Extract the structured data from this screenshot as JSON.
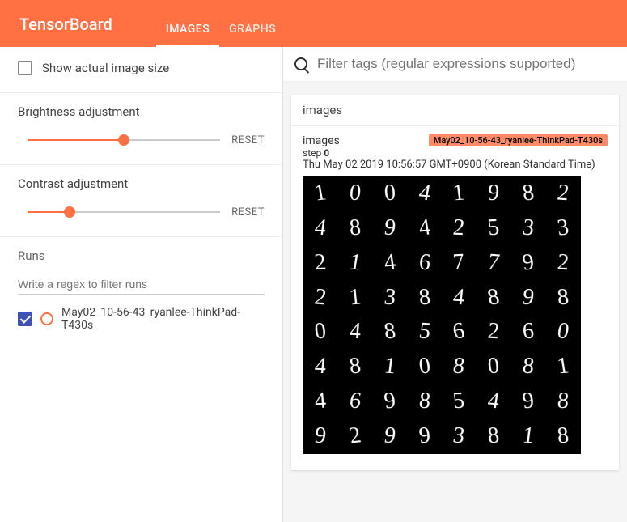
{
  "header": {
    "brand": "TensorBoard",
    "tabs": [
      {
        "label": "IMAGES",
        "active": true
      },
      {
        "label": "GRAPHS",
        "active": false
      }
    ]
  },
  "sidebar": {
    "show_actual_label": "Show actual image size",
    "show_actual_checked": false,
    "brightness": {
      "title": "Brightness adjustment",
      "reset_label": "RESET",
      "value_pct": 50
    },
    "contrast": {
      "title": "Contrast adjustment",
      "reset_label": "RESET",
      "value_pct": 22
    },
    "runs": {
      "title": "Runs",
      "filter_placeholder": "Write a regex to filter runs",
      "items": [
        {
          "checked": true,
          "label": "May02_10-56-43_ryanlee-ThinkPad-T430s"
        }
      ]
    }
  },
  "content": {
    "search_placeholder": "Filter tags (regular expressions supported)",
    "card": {
      "header": "images",
      "tag": "images",
      "badge": "May02_10-56-43_ryanlee-ThinkPad-T430s",
      "step_label": "step",
      "step_value": "0",
      "timestamp": "Thu May 02 2019 10:56:57 GMT+0900 (Korean Standard Time)",
      "digits": [
        [
          "1",
          "0",
          "0",
          "4",
          "1",
          "9",
          "8",
          "2"
        ],
        [
          "4",
          "8",
          "9",
          "4",
          "2",
          "5",
          "3",
          "3"
        ],
        [
          "2",
          "1",
          "4",
          "6",
          "7",
          "7",
          "9",
          "2"
        ],
        [
          "2",
          "1",
          "3",
          "8",
          "4",
          "8",
          "9",
          "8"
        ],
        [
          "0",
          "4",
          "8",
          "5",
          "6",
          "2",
          "6",
          "0"
        ],
        [
          "4",
          "8",
          "1",
          "0",
          "8",
          "0",
          "8",
          "1"
        ],
        [
          "4",
          "6",
          "9",
          "8",
          "5",
          "4",
          "9",
          "8"
        ],
        [
          "9",
          "2",
          "9",
          "9",
          "3",
          "8",
          "1",
          "8"
        ]
      ]
    }
  }
}
